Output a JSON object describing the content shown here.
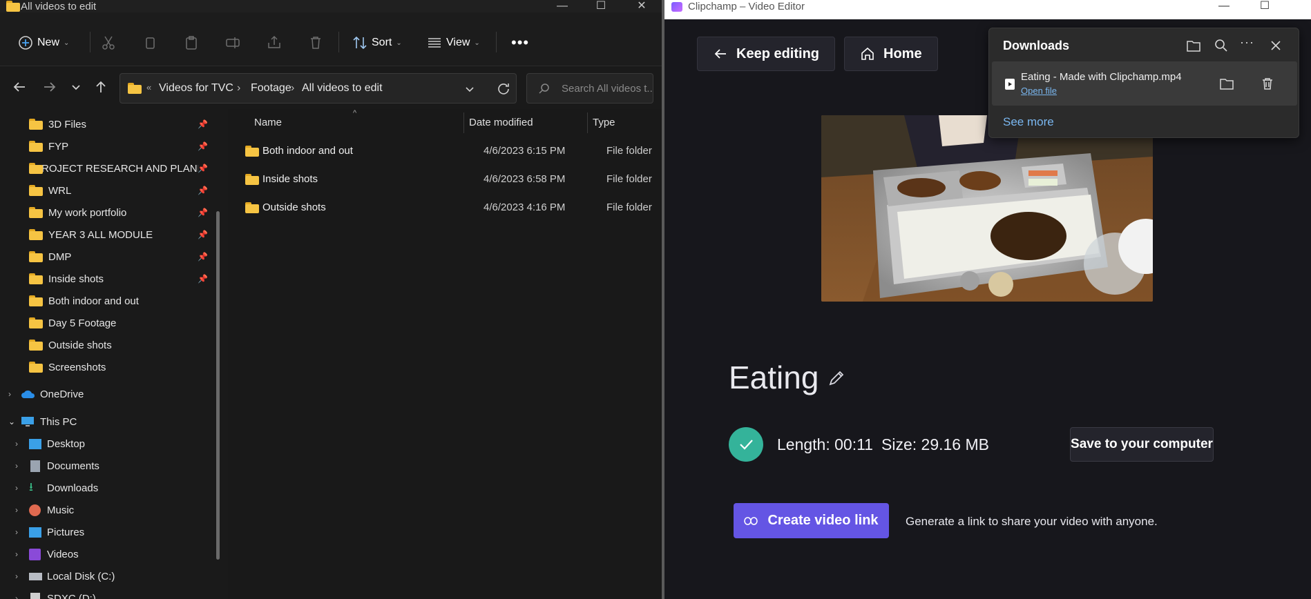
{
  "explorer": {
    "window_title": "All videos to edit",
    "toolbar": {
      "new_label": "New",
      "sort_label": "Sort",
      "view_label": "View"
    },
    "breadcrumbs": [
      "Videos for TVC",
      "Footage",
      "All videos to edit"
    ],
    "search_placeholder": "Search All videos t...",
    "quick_access": [
      {
        "label": "3D Files",
        "pinned": true
      },
      {
        "label": "FYP",
        "pinned": true
      },
      {
        "label": "PROJECT RESEARCH AND PLANN",
        "pinned": true
      },
      {
        "label": "WRL",
        "pinned": true
      },
      {
        "label": "My work portfolio",
        "pinned": true
      },
      {
        "label": "YEAR 3 ALL MODULE",
        "pinned": true
      },
      {
        "label": "DMP",
        "pinned": true
      },
      {
        "label": "Inside shots",
        "pinned": true
      },
      {
        "label": "Both indoor and out",
        "pinned": false
      },
      {
        "label": "Day 5 Footage",
        "pinned": false
      },
      {
        "label": "Outside shots",
        "pinned": false
      },
      {
        "label": "Screenshots",
        "pinned": false
      }
    ],
    "onedrive_label": "OneDrive",
    "thispc_label": "This PC",
    "thispc_items": [
      "Desktop",
      "Documents",
      "Downloads",
      "Music",
      "Pictures",
      "Videos",
      "Local Disk (C:)",
      "SDXC (D:)"
    ],
    "columns": {
      "name": "Name",
      "date": "Date modified",
      "type": "Type"
    },
    "files": [
      {
        "name": "Both indoor and out",
        "date": "4/6/2023 6:15 PM",
        "type": "File folder"
      },
      {
        "name": "Inside shots",
        "date": "4/6/2023 6:58 PM",
        "type": "File folder"
      },
      {
        "name": "Outside shots",
        "date": "4/6/2023 4:16 PM",
        "type": "File folder"
      }
    ]
  },
  "clipchamp": {
    "window_title": "Clipchamp – Video Editor",
    "keep_editing_label": "Keep editing",
    "home_label": "Home",
    "video_title": "Eating",
    "length_text": "Length: 00:11",
    "size_text": "Size: 29.16 MB",
    "save_label": "Save to your computer",
    "create_link_label": "Create video link",
    "link_description": "Generate a link to share your video with anyone.",
    "accent_color": "#6455e4",
    "success_color": "#34b39a"
  },
  "downloads": {
    "title": "Downloads",
    "file_name": "Eating - Made with Clipchamp.mp4",
    "open_file_label": "Open file",
    "see_more_label": "See more"
  }
}
